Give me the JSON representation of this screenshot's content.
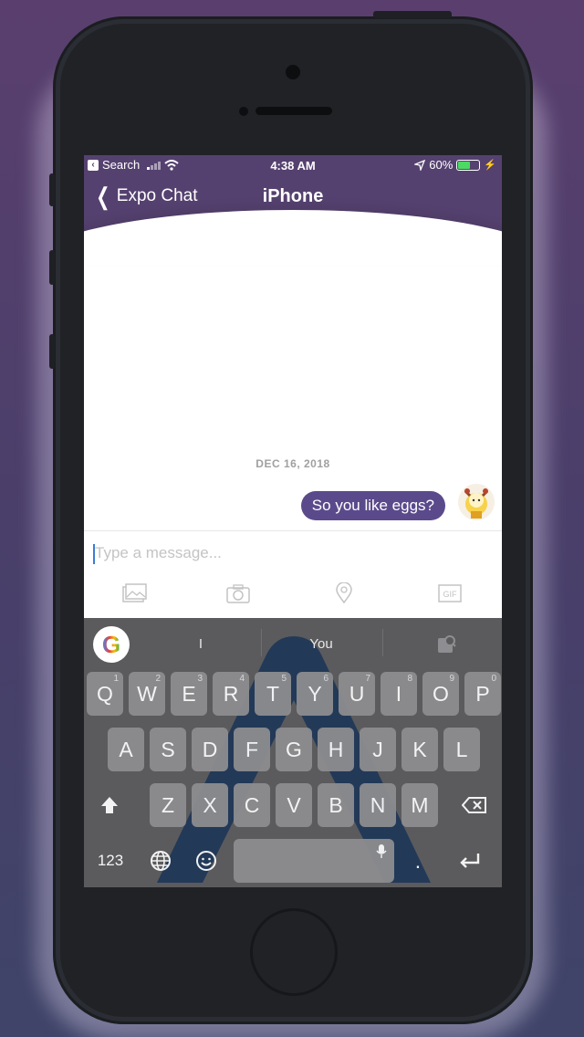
{
  "status_bar": {
    "back_app": "Search",
    "time": "4:38 AM",
    "battery": "60%",
    "battery_level": 0.6
  },
  "nav": {
    "back_label": "Expo Chat",
    "title": "iPhone"
  },
  "chat": {
    "date": "DEC 16, 2018",
    "messages": [
      {
        "text": "So you like eggs?",
        "from": "me"
      }
    ]
  },
  "composer": {
    "placeholder": "Type a message..."
  },
  "actions": {
    "icons": [
      "image-icon",
      "camera-icon",
      "location-pin-icon",
      "gif-icon"
    ],
    "gif_label": "GIF"
  },
  "keyboard": {
    "suggestions": [
      "I",
      "You"
    ],
    "google_label": "G",
    "row1": [
      {
        "k": "Q",
        "n": "1"
      },
      {
        "k": "W",
        "n": "2"
      },
      {
        "k": "E",
        "n": "3"
      },
      {
        "k": "R",
        "n": "4"
      },
      {
        "k": "T",
        "n": "5"
      },
      {
        "k": "Y",
        "n": "6"
      },
      {
        "k": "U",
        "n": "7"
      },
      {
        "k": "I",
        "n": "8"
      },
      {
        "k": "O",
        "n": "9"
      },
      {
        "k": "P",
        "n": "0"
      }
    ],
    "row2": [
      "A",
      "S",
      "D",
      "F",
      "G",
      "H",
      "J",
      "K",
      "L"
    ],
    "row3": [
      "Z",
      "X",
      "C",
      "V",
      "B",
      "N",
      "M"
    ],
    "numbers_label": "123",
    "period": ".",
    "colors": {
      "keyboard_bg": "#5b5b5d",
      "key": "#8e8e91"
    }
  },
  "colors": {
    "header": "#55416f",
    "bubble": "#5b4a8b",
    "background": "#4a3f6a"
  }
}
